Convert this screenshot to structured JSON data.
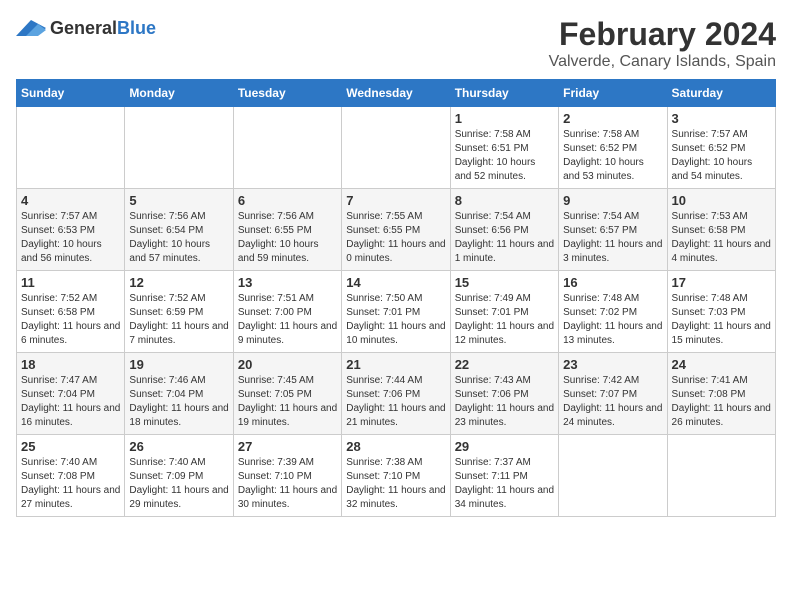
{
  "logo": {
    "general": "General",
    "blue": "Blue"
  },
  "title": "February 2024",
  "subtitle": "Valverde, Canary Islands, Spain",
  "days_of_week": [
    "Sunday",
    "Monday",
    "Tuesday",
    "Wednesday",
    "Thursday",
    "Friday",
    "Saturday"
  ],
  "weeks": [
    [
      {
        "day": "",
        "info": ""
      },
      {
        "day": "",
        "info": ""
      },
      {
        "day": "",
        "info": ""
      },
      {
        "day": "",
        "info": ""
      },
      {
        "day": "1",
        "info": "Sunrise: 7:58 AM\nSunset: 6:51 PM\nDaylight: 10 hours and 52 minutes."
      },
      {
        "day": "2",
        "info": "Sunrise: 7:58 AM\nSunset: 6:52 PM\nDaylight: 10 hours and 53 minutes."
      },
      {
        "day": "3",
        "info": "Sunrise: 7:57 AM\nSunset: 6:52 PM\nDaylight: 10 hours and 54 minutes."
      }
    ],
    [
      {
        "day": "4",
        "info": "Sunrise: 7:57 AM\nSunset: 6:53 PM\nDaylight: 10 hours and 56 minutes."
      },
      {
        "day": "5",
        "info": "Sunrise: 7:56 AM\nSunset: 6:54 PM\nDaylight: 10 hours and 57 minutes."
      },
      {
        "day": "6",
        "info": "Sunrise: 7:56 AM\nSunset: 6:55 PM\nDaylight: 10 hours and 59 minutes."
      },
      {
        "day": "7",
        "info": "Sunrise: 7:55 AM\nSunset: 6:55 PM\nDaylight: 11 hours and 0 minutes."
      },
      {
        "day": "8",
        "info": "Sunrise: 7:54 AM\nSunset: 6:56 PM\nDaylight: 11 hours and 1 minute."
      },
      {
        "day": "9",
        "info": "Sunrise: 7:54 AM\nSunset: 6:57 PM\nDaylight: 11 hours and 3 minutes."
      },
      {
        "day": "10",
        "info": "Sunrise: 7:53 AM\nSunset: 6:58 PM\nDaylight: 11 hours and 4 minutes."
      }
    ],
    [
      {
        "day": "11",
        "info": "Sunrise: 7:52 AM\nSunset: 6:58 PM\nDaylight: 11 hours and 6 minutes."
      },
      {
        "day": "12",
        "info": "Sunrise: 7:52 AM\nSunset: 6:59 PM\nDaylight: 11 hours and 7 minutes."
      },
      {
        "day": "13",
        "info": "Sunrise: 7:51 AM\nSunset: 7:00 PM\nDaylight: 11 hours and 9 minutes."
      },
      {
        "day": "14",
        "info": "Sunrise: 7:50 AM\nSunset: 7:01 PM\nDaylight: 11 hours and 10 minutes."
      },
      {
        "day": "15",
        "info": "Sunrise: 7:49 AM\nSunset: 7:01 PM\nDaylight: 11 hours and 12 minutes."
      },
      {
        "day": "16",
        "info": "Sunrise: 7:48 AM\nSunset: 7:02 PM\nDaylight: 11 hours and 13 minutes."
      },
      {
        "day": "17",
        "info": "Sunrise: 7:48 AM\nSunset: 7:03 PM\nDaylight: 11 hours and 15 minutes."
      }
    ],
    [
      {
        "day": "18",
        "info": "Sunrise: 7:47 AM\nSunset: 7:04 PM\nDaylight: 11 hours and 16 minutes."
      },
      {
        "day": "19",
        "info": "Sunrise: 7:46 AM\nSunset: 7:04 PM\nDaylight: 11 hours and 18 minutes."
      },
      {
        "day": "20",
        "info": "Sunrise: 7:45 AM\nSunset: 7:05 PM\nDaylight: 11 hours and 19 minutes."
      },
      {
        "day": "21",
        "info": "Sunrise: 7:44 AM\nSunset: 7:06 PM\nDaylight: 11 hours and 21 minutes."
      },
      {
        "day": "22",
        "info": "Sunrise: 7:43 AM\nSunset: 7:06 PM\nDaylight: 11 hours and 23 minutes."
      },
      {
        "day": "23",
        "info": "Sunrise: 7:42 AM\nSunset: 7:07 PM\nDaylight: 11 hours and 24 minutes."
      },
      {
        "day": "24",
        "info": "Sunrise: 7:41 AM\nSunset: 7:08 PM\nDaylight: 11 hours and 26 minutes."
      }
    ],
    [
      {
        "day": "25",
        "info": "Sunrise: 7:40 AM\nSunset: 7:08 PM\nDaylight: 11 hours and 27 minutes."
      },
      {
        "day": "26",
        "info": "Sunrise: 7:40 AM\nSunset: 7:09 PM\nDaylight: 11 hours and 29 minutes."
      },
      {
        "day": "27",
        "info": "Sunrise: 7:39 AM\nSunset: 7:10 PM\nDaylight: 11 hours and 30 minutes."
      },
      {
        "day": "28",
        "info": "Sunrise: 7:38 AM\nSunset: 7:10 PM\nDaylight: 11 hours and 32 minutes."
      },
      {
        "day": "29",
        "info": "Sunrise: 7:37 AM\nSunset: 7:11 PM\nDaylight: 11 hours and 34 minutes."
      },
      {
        "day": "",
        "info": ""
      },
      {
        "day": "",
        "info": ""
      }
    ]
  ]
}
